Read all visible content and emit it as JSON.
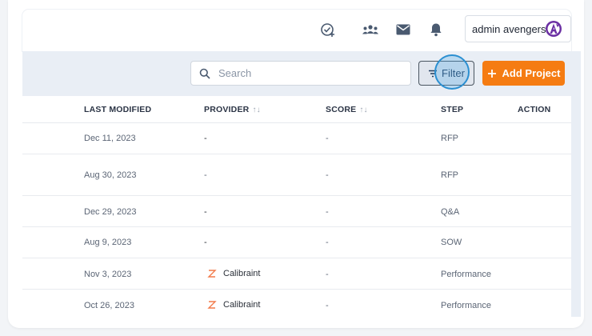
{
  "user": {
    "name": "admin avengers"
  },
  "header_icons": [
    "check-plus-icon",
    "team-icon",
    "mail-icon",
    "bell-icon"
  ],
  "search": {
    "placeholder": "Search"
  },
  "filter": {
    "label": "Filter"
  },
  "add_project": {
    "label": "Add Project"
  },
  "colors": {
    "accent": "#f57c12",
    "toolbar_bg": "#e9eef5",
    "highlight": "#2a8fd1"
  },
  "table": {
    "columns": {
      "last_modified": "LAST MODIFIED",
      "provider": "PROVIDER",
      "score": "SCORE",
      "step": "STEP",
      "action": "ACTION"
    },
    "sort_glyph": "↑↓",
    "rows": [
      {
        "last_modified": "Dec 11, 2023",
        "provider": "-",
        "score": "-",
        "step": "RFP"
      },
      {
        "last_modified": "Aug 30, 2023",
        "provider": "-",
        "score": "-",
        "step": "RFP"
      },
      {
        "last_modified": "Dec 29, 2023",
        "provider": "-",
        "score": "-",
        "step": "Q&A"
      },
      {
        "last_modified": "Aug 9, 2023",
        "provider": "-",
        "score": "-",
        "step": "SOW"
      },
      {
        "last_modified": "Nov 3, 2023",
        "provider": "Calibraint",
        "score": "-",
        "step": "Performance"
      },
      {
        "last_modified": "Oct 26, 2023",
        "provider": "Calibraint",
        "score": "-",
        "step": "Performance"
      }
    ]
  }
}
